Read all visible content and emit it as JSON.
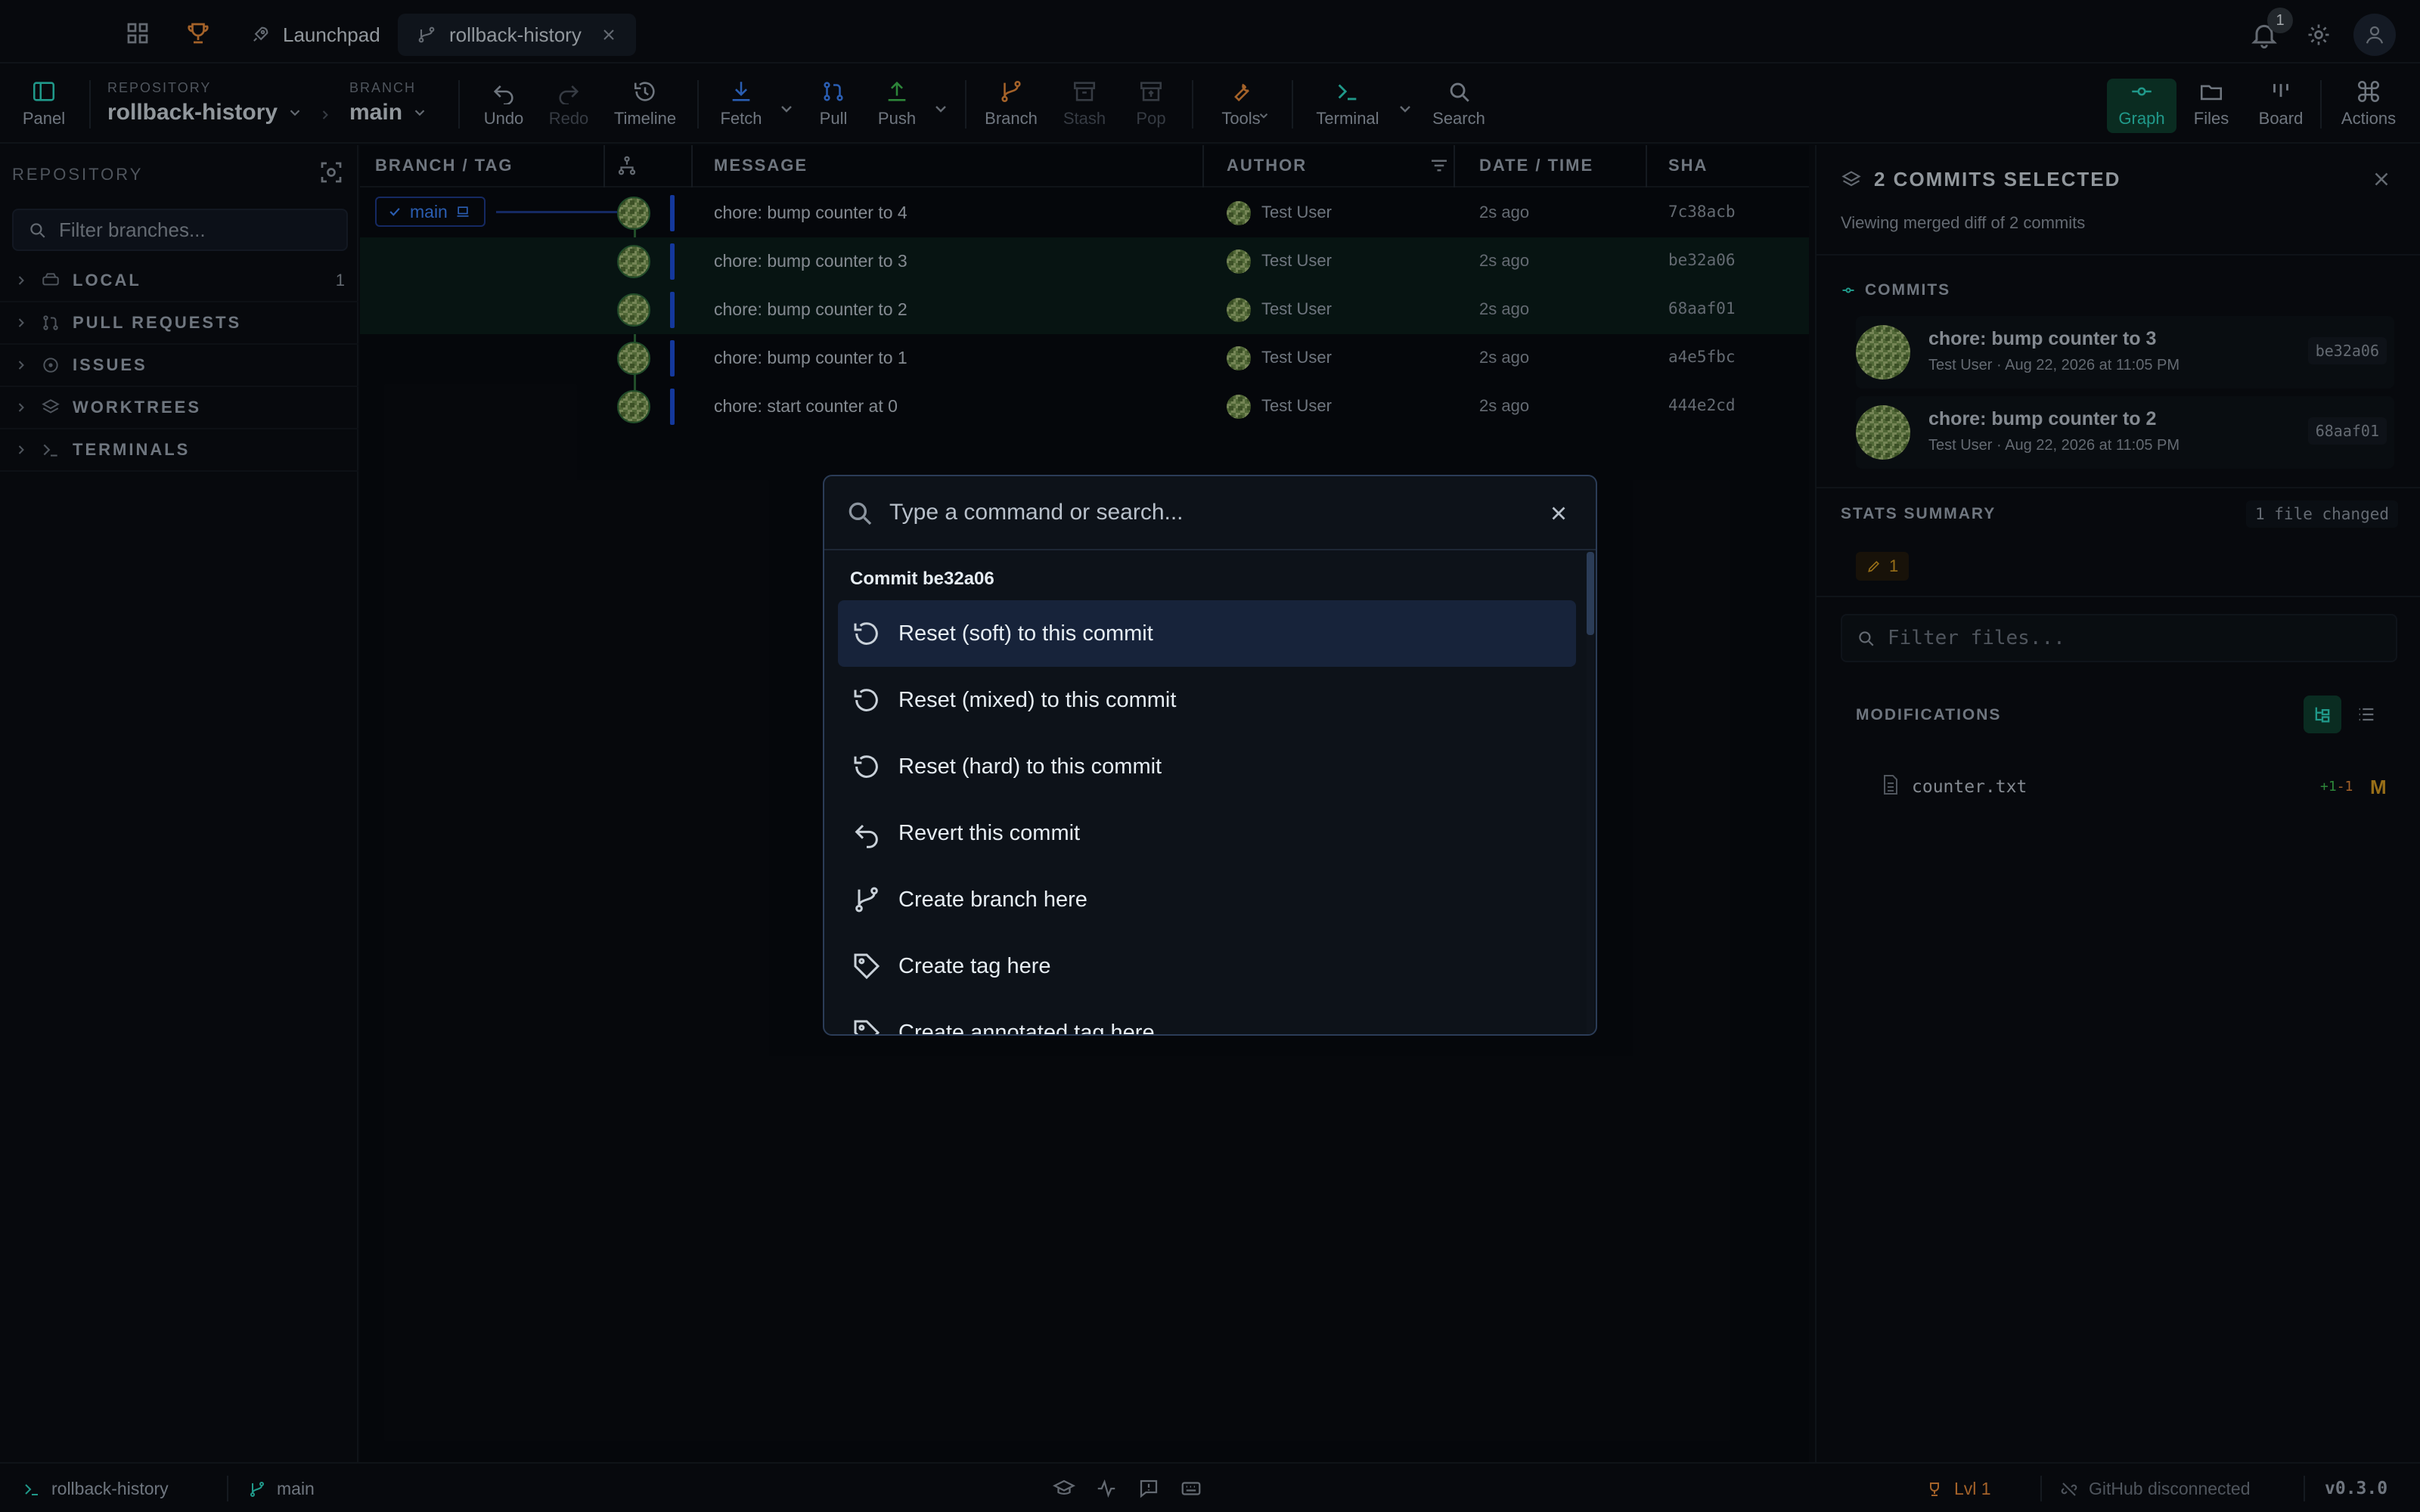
{
  "tabs": {
    "launchpad_label": "Launchpad",
    "repo_tab_label": "rollback-history",
    "notification_count": "1"
  },
  "toolbar": {
    "panel_label": "Panel",
    "repository_caption": "REPOSITORY",
    "repository_name": "rollback-history",
    "branch_caption": "BRANCH",
    "branch_name": "main",
    "undo_label": "Undo",
    "redo_label": "Redo",
    "timeline_label": "Timeline",
    "fetch_label": "Fetch",
    "pull_label": "Pull",
    "push_label": "Push",
    "branch_label": "Branch",
    "stash_label": "Stash",
    "pop_label": "Pop",
    "tools_label": "Tools",
    "terminal_label": "Terminal",
    "search_label": "Search",
    "graph_label": "Graph",
    "files_label": "Files",
    "board_label": "Board",
    "actions_label": "Actions"
  },
  "sidebar": {
    "title": "REPOSITORY",
    "search_placeholder": "Filter branches...",
    "sections": [
      {
        "label": "LOCAL",
        "count": "1",
        "icon": "drive-icon"
      },
      {
        "label": "PULL REQUESTS",
        "count": "",
        "icon": "pull-request-icon"
      },
      {
        "label": "ISSUES",
        "count": "",
        "icon": "issue-icon"
      },
      {
        "label": "WORKTREES",
        "count": "",
        "icon": "layers-icon"
      },
      {
        "label": "TERMINALS",
        "count": "",
        "icon": "terminal-icon"
      }
    ]
  },
  "graph": {
    "columns": {
      "branch_tag": "BRANCH / TAG",
      "message": "MESSAGE",
      "author": "AUTHOR",
      "date_time": "DATE / TIME",
      "sha": "SHA"
    },
    "branch_chip": "main",
    "rows": [
      {
        "message": "chore: bump counter to 4",
        "author": "Test User",
        "date": "2s ago",
        "sha": "7c38acb",
        "selected": false
      },
      {
        "message": "chore: bump counter to 3",
        "author": "Test User",
        "date": "2s ago",
        "sha": "be32a06",
        "selected": true
      },
      {
        "message": "chore: bump counter to 2",
        "author": "Test User",
        "date": "2s ago",
        "sha": "68aaf01",
        "selected": true
      },
      {
        "message": "chore: bump counter to 1",
        "author": "Test User",
        "date": "2s ago",
        "sha": "a4e5fbc",
        "selected": false
      },
      {
        "message": "chore: start counter at 0",
        "author": "Test User",
        "date": "2s ago",
        "sha": "444e2cd",
        "selected": false
      }
    ]
  },
  "right_panel": {
    "title": "2 COMMITS SELECTED",
    "subtitle": "Viewing merged diff of 2 commits",
    "commits_title": "COMMITS",
    "commits": [
      {
        "title": "chore: bump counter to 3",
        "meta": "Test User · Aug 22, 2026 at 11:05 PM",
        "sha": "be32a06"
      },
      {
        "title": "chore: bump counter to 2",
        "meta": "Test User · Aug 22, 2026 at 11:05 PM",
        "sha": "68aaf01"
      }
    ],
    "stats_title": "STATS SUMMARY",
    "files_changed": "1 file changed",
    "edits_count": "1",
    "filter_placeholder": "Filter files...",
    "modifications_title": "MODIFICATIONS",
    "file": {
      "name": "counter.txt",
      "additions": "+1",
      "deletions": "-1",
      "status": "M"
    }
  },
  "palette": {
    "placeholder": "Type a command or search...",
    "group_label": "Commit be32a06",
    "items": [
      {
        "label": "Reset (soft) to this commit",
        "icon": "reset-icon"
      },
      {
        "label": "Reset (mixed) to this commit",
        "icon": "reset-icon"
      },
      {
        "label": "Reset (hard) to this commit",
        "icon": "reset-icon"
      },
      {
        "label": "Revert this commit",
        "icon": "undo-arrow-icon"
      },
      {
        "label": "Create branch here",
        "icon": "branch-icon"
      },
      {
        "label": "Create tag here",
        "icon": "tag-icon"
      },
      {
        "label": "Create annotated tag here",
        "icon": "tag-icon"
      }
    ]
  },
  "statusbar": {
    "repo": "rollback-history",
    "branch": "main",
    "level": "Lvl 1",
    "github": "GitHub disconnected",
    "version": "v0.3.0"
  },
  "colors": {
    "background": "#0a0d12",
    "accent_teal": "#2dd4bf",
    "accent_blue": "#3b82f6",
    "accent_orange": "#e3883a",
    "status_modified": "#d29922"
  }
}
